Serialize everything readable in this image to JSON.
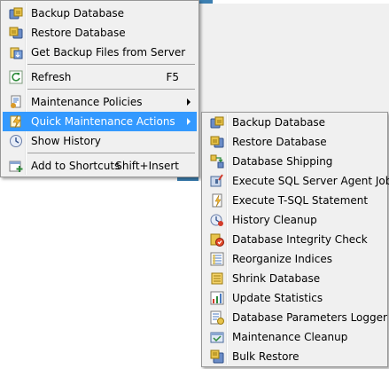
{
  "main_menu": {
    "items": [
      {
        "label": "Backup Database",
        "shortcut": "",
        "icon": "backup-db-icon"
      },
      {
        "label": "Restore Database",
        "shortcut": "",
        "icon": "restore-db-icon"
      },
      {
        "label": "Get Backup Files from Server",
        "shortcut": "",
        "icon": "backup-files-icon"
      },
      {
        "label": "Refresh",
        "shortcut": "F5",
        "icon": "refresh-icon"
      },
      {
        "label": "Maintenance Policies",
        "shortcut": "",
        "icon": "policies-icon"
      },
      {
        "label": "Quick Maintenance Actions",
        "shortcut": "",
        "icon": "quick-actions-icon"
      },
      {
        "label": "Show History",
        "shortcut": "",
        "icon": "history-icon"
      },
      {
        "label": "Add to Shortcuts",
        "shortcut": "Shift+Insert",
        "icon": "add-shortcut-icon"
      }
    ]
  },
  "sub_menu": {
    "items": [
      {
        "label": "Backup Database",
        "icon": "backup-db-icon"
      },
      {
        "label": "Restore Database",
        "icon": "restore-db-icon"
      },
      {
        "label": "Database Shipping",
        "icon": "shipping-icon"
      },
      {
        "label": "Execute SQL Server Agent Job",
        "icon": "agent-job-icon"
      },
      {
        "label": "Execute T-SQL Statement",
        "icon": "tsql-icon"
      },
      {
        "label": "History Cleanup",
        "icon": "history-cleanup-icon"
      },
      {
        "label": "Database Integrity Check",
        "icon": "integrity-icon"
      },
      {
        "label": "Reorganize Indices",
        "icon": "reorganize-icon"
      },
      {
        "label": "Shrink Database",
        "icon": "shrink-icon"
      },
      {
        "label": "Update Statistics",
        "icon": "statistics-icon"
      },
      {
        "label": "Database Parameters Logger",
        "icon": "params-logger-icon"
      },
      {
        "label": "Maintenance Cleanup",
        "icon": "maint-cleanup-icon"
      },
      {
        "label": "Bulk Restore",
        "icon": "bulk-restore-icon"
      }
    ]
  },
  "colors": {
    "highlight": "#3399ff",
    "menu_bg": "#f0f0f0",
    "border": "#979797"
  }
}
